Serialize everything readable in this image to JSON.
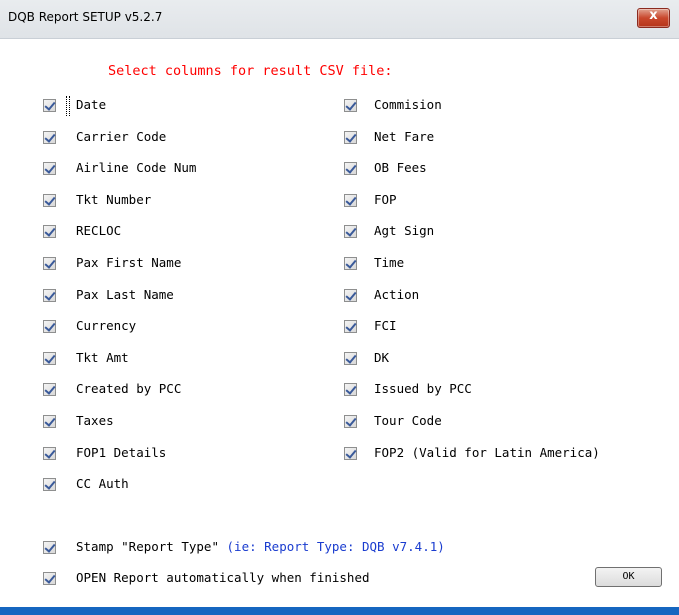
{
  "window": {
    "title": "DQB Report SETUP v5.2.7",
    "close_glyph": "x"
  },
  "heading": "Select columns for result CSV file:",
  "columns_left": [
    {
      "label": "Date",
      "checked": true
    },
    {
      "label": "Carrier Code",
      "checked": true
    },
    {
      "label": "Airline Code Num",
      "checked": true
    },
    {
      "label": "Tkt Number",
      "checked": true
    },
    {
      "label": "RECLOC",
      "checked": true
    },
    {
      "label": "Pax First Name",
      "checked": true
    },
    {
      "label": "Pax Last Name",
      "checked": true
    },
    {
      "label": "Currency",
      "checked": true
    },
    {
      "label": "Tkt Amt",
      "checked": true
    },
    {
      "label": "Created by PCC",
      "checked": true
    },
    {
      "label": "Taxes",
      "checked": true
    },
    {
      "label": "FOP1 Details",
      "checked": true
    },
    {
      "label": "CC Auth",
      "checked": true
    }
  ],
  "columns_right": [
    {
      "label": "Commision",
      "checked": true
    },
    {
      "label": "Net Fare",
      "checked": true
    },
    {
      "label": "OB Fees",
      "checked": true
    },
    {
      "label": "FOP",
      "checked": true
    },
    {
      "label": "Agt Sign",
      "checked": true
    },
    {
      "label": "Time",
      "checked": true
    },
    {
      "label": "Action",
      "checked": true
    },
    {
      "label": "FCI",
      "checked": true
    },
    {
      "label": "DK",
      "checked": true
    },
    {
      "label": "Issued by PCC",
      "checked": true
    },
    {
      "label": "Tour Code",
      "checked": true
    },
    {
      "label": "FOP2 (Valid for Latin America)",
      "checked": true
    }
  ],
  "options": {
    "stamp_label": "Stamp \"Report Type\"",
    "stamp_hint": "(ie: Report Type: DQB v7.4.1)",
    "stamp_checked": true,
    "open_label": "OPEN Report automatically when finished",
    "open_checked": true
  },
  "ok_label": "OK",
  "colors": {
    "heading": "#ff0000",
    "hint": "#1a3ccf",
    "close_button": "#c9472c",
    "bottom_border": "#1566c0"
  }
}
